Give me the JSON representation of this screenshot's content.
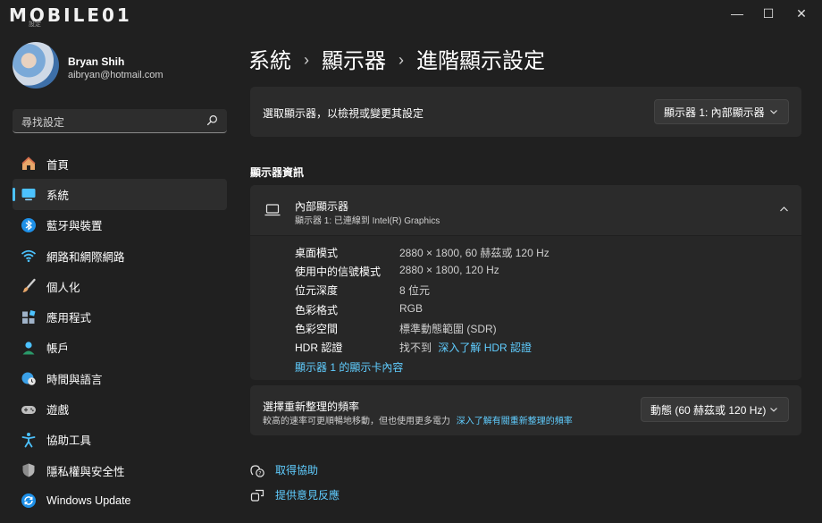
{
  "titlebar": {
    "logo_text": "MOBILE01",
    "logo_sub": "設定",
    "minimize": "—",
    "maximize": "☐",
    "close": "✕"
  },
  "profile": {
    "name": "Bryan Shih",
    "email": "aibryan@hotmail.com"
  },
  "search": {
    "placeholder": "尋找設定"
  },
  "nav": [
    {
      "label": "首頁",
      "icon": "home-icon"
    },
    {
      "label": "系統",
      "icon": "monitor-icon",
      "active": true
    },
    {
      "label": "藍牙與裝置",
      "icon": "bluetooth-icon"
    },
    {
      "label": "網路和網際網路",
      "icon": "wifi-icon"
    },
    {
      "label": "個人化",
      "icon": "brush-icon"
    },
    {
      "label": "應用程式",
      "icon": "apps-icon"
    },
    {
      "label": "帳戶",
      "icon": "account-icon"
    },
    {
      "label": "時間與語言",
      "icon": "globe-clock-icon"
    },
    {
      "label": "遊戲",
      "icon": "gamepad-icon"
    },
    {
      "label": "協助工具",
      "icon": "accessibility-icon"
    },
    {
      "label": "隱私權與安全性",
      "icon": "shield-icon"
    },
    {
      "label": "Windows Update",
      "icon": "update-icon"
    }
  ],
  "breadcrumb": {
    "level1": "系統",
    "level2": "顯示器",
    "level3": "進階顯示設定",
    "sep": "›"
  },
  "select_display": {
    "label": "選取顯示器，以檢視或變更其設定",
    "value": "顯示器 1: 內部顯示器"
  },
  "display_info": {
    "section_title": "顯示器資訊",
    "monitor_title": "內部顯示器",
    "monitor_sub": "顯示器 1: 已連線到 Intel(R) Graphics",
    "rows": [
      {
        "label": "桌面模式",
        "value": "2880 × 1800, 60 赫茲或 120 Hz"
      },
      {
        "label": "使用中的信號模式",
        "value": "2880 × 1800, 120 Hz"
      },
      {
        "label": "位元深度",
        "value": "8 位元"
      },
      {
        "label": "色彩格式",
        "value": "RGB"
      },
      {
        "label": "色彩空間",
        "value": "標準動態範圍 (SDR)"
      }
    ],
    "hdr_label": "HDR 認證",
    "hdr_value": "找不到",
    "hdr_link": "深入了解 HDR 認證",
    "adapter_link": "顯示器 1 的顯示卡內容"
  },
  "refresh": {
    "title": "選擇重新整理的頻率",
    "sub": "較高的速率可更順暢地移動，但也使用更多電力",
    "link": "深入了解有關重新整理的頻率",
    "value": "動態 (60 赫茲或 120 Hz)"
  },
  "help": {
    "get_help": "取得協助",
    "feedback": "提供意見反應"
  },
  "colors": {
    "accent": "#4cc2ff",
    "link": "#60cdff",
    "background": "#202020",
    "card": "#2b2b2b"
  }
}
